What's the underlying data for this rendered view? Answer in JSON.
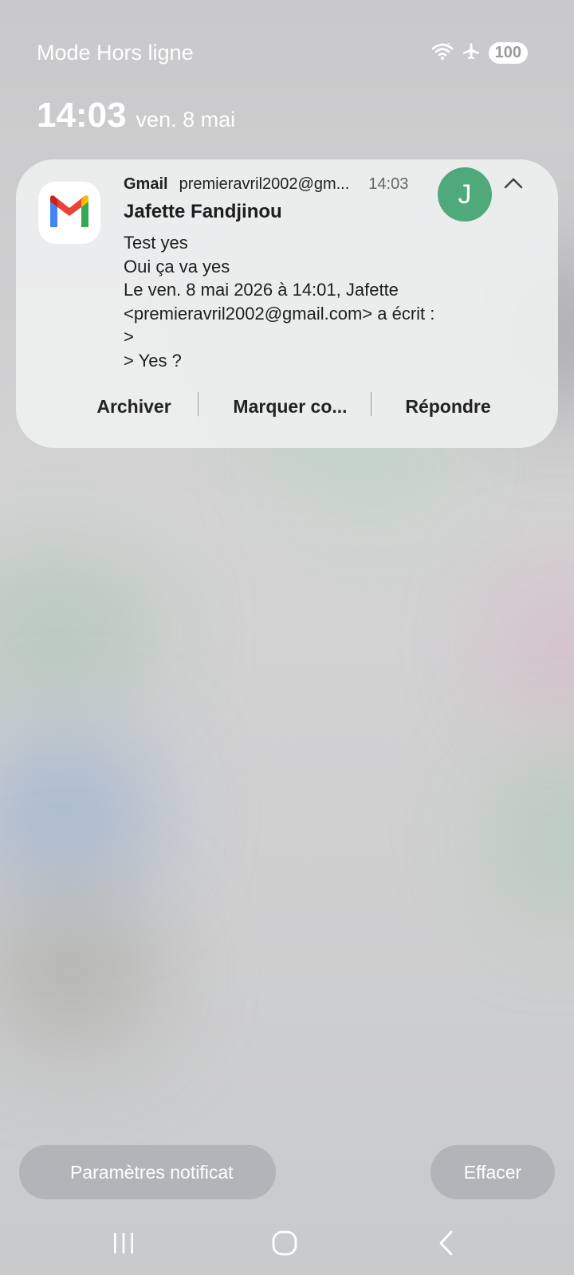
{
  "status_bar": {
    "mode": "Mode Hors ligne",
    "battery": "100"
  },
  "lockscreen": {
    "time": "14:03",
    "date": "ven. 8 mai"
  },
  "notification": {
    "app": "Gmail",
    "account": "premieravril2002@gm...",
    "time": "14:03",
    "avatar_letter": "J",
    "avatar_color": "#4fa97b",
    "sender": "Jafette Fandjinou",
    "lines": [
      "Test yes",
      "Oui ça va yes",
      "Le ven. 8 mai 2026 à 14:01, Jafette",
      "<premieravril2002@gmail.com> a écrit :",
      ">",
      "> Yes ?"
    ],
    "actions": {
      "archive": "Archiver",
      "mark": "Marquer co...",
      "reply": "Répondre"
    }
  },
  "bottom": {
    "settings": "Paramètres notificat",
    "clear": "Effacer"
  },
  "icons": [
    "wifi-icon",
    "airplane-icon",
    "gmail-icon",
    "chevron-up-icon",
    "recents-icon",
    "home-icon",
    "back-icon"
  ]
}
